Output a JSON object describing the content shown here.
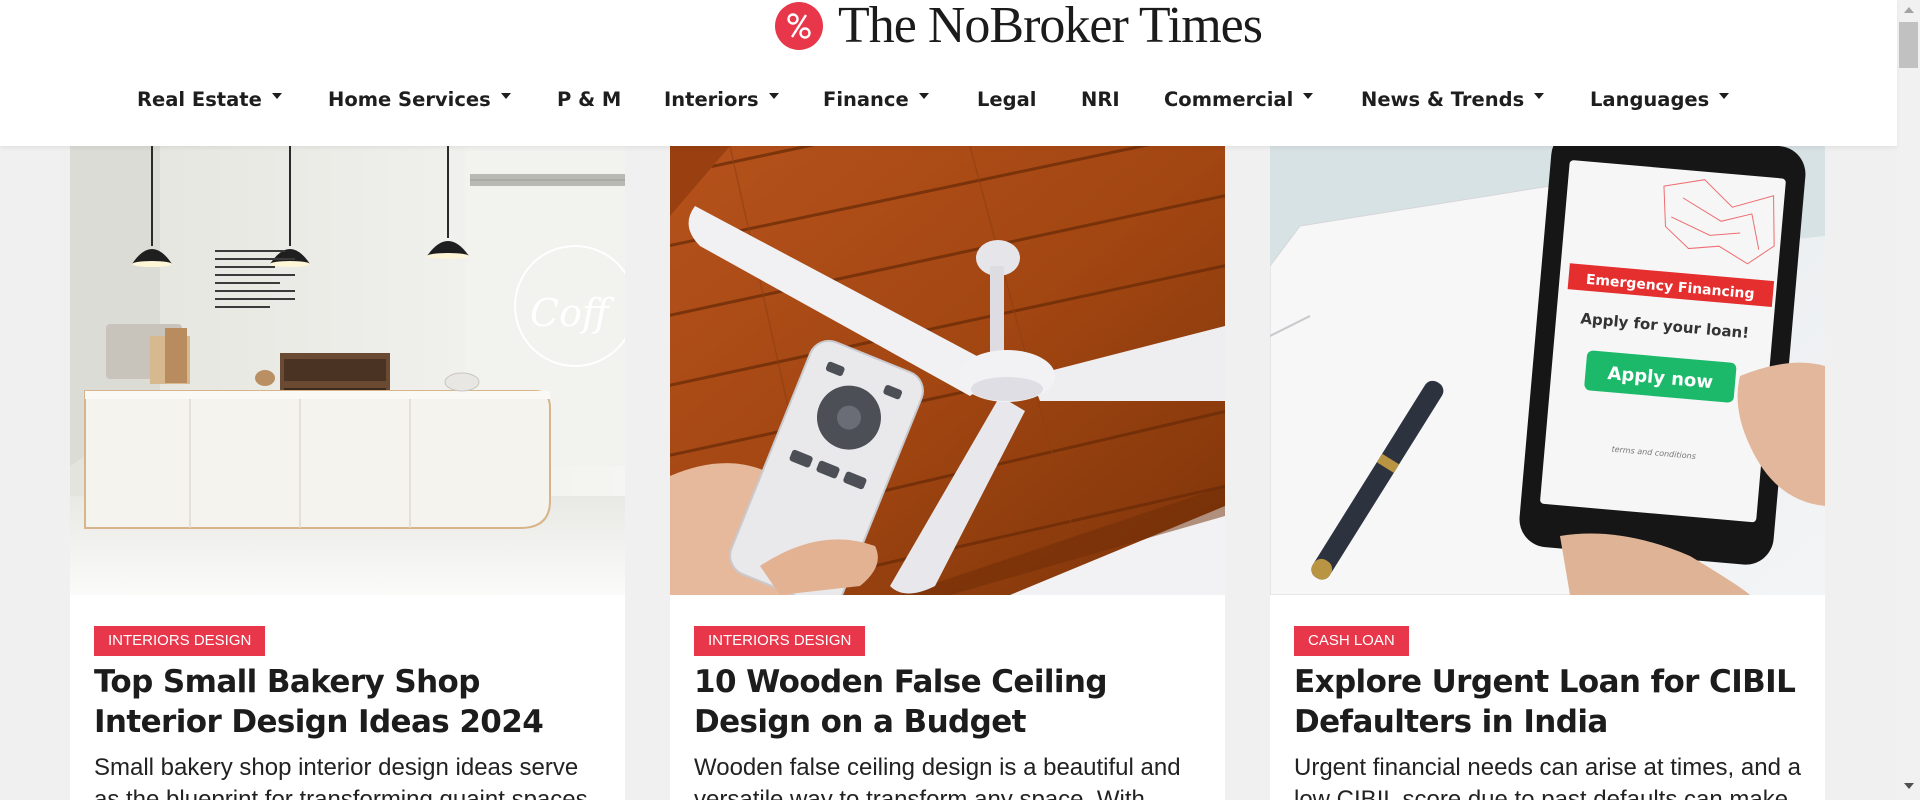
{
  "site": {
    "name": "The NoBroker Times",
    "logo_icon": "percent-icon",
    "brand_color": "#e8374a"
  },
  "nav": {
    "items": [
      {
        "label": "Real Estate",
        "dropdown": true
      },
      {
        "label": "Home Services",
        "dropdown": true
      },
      {
        "label": "P & M",
        "dropdown": false
      },
      {
        "label": "Interiors",
        "dropdown": true
      },
      {
        "label": "Finance",
        "dropdown": true
      },
      {
        "label": "Legal",
        "dropdown": false
      },
      {
        "label": "NRI",
        "dropdown": false
      },
      {
        "label": "Commercial",
        "dropdown": true
      },
      {
        "label": "News & Trends",
        "dropdown": true
      },
      {
        "label": "Languages",
        "dropdown": true
      }
    ]
  },
  "cards": [
    {
      "image": "bakery-shop-interior-image",
      "category": "INTERIORS DESIGN",
      "title": "Top Small Bakery Shop Interior Design Ideas 2024",
      "excerpt": "Small bakery shop interior design ideas serve as the blueprint for transforming quaint spaces"
    },
    {
      "image": "wooden-ceiling-fan-remote-image",
      "category": "INTERIORS DESIGN",
      "title": "10 Wooden False Ceiling Design on a Budget",
      "excerpt": "Wooden false ceiling design is a beautiful and versatile way to transform any space. With"
    },
    {
      "image": "phone-emergency-loan-image",
      "category": "CASH LOAN",
      "title": "Explore Urgent Loan for CIBIL Defaulters in India",
      "excerpt": "Urgent financial needs can arise at times, and a low CIBIL score due to past defaults can make",
      "phone_text": {
        "banner": "Emergency Financing",
        "prompt": "Apply for your loan!",
        "button": "Apply now",
        "terms": "terms and conditions"
      }
    }
  ]
}
